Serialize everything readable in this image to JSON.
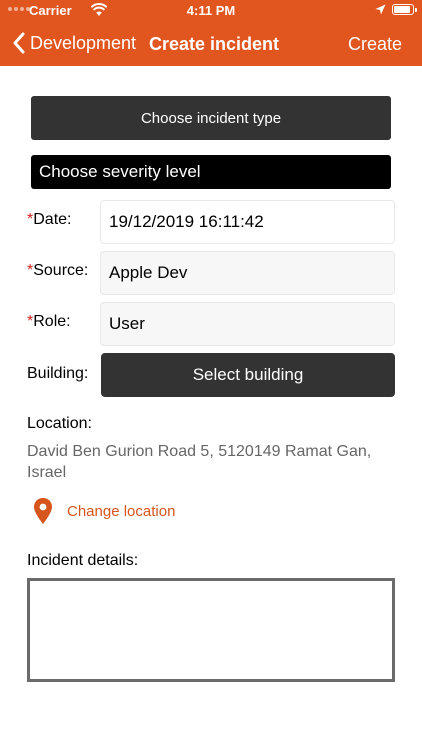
{
  "status_bar": {
    "carrier": "Carrier",
    "time": "4:11 PM",
    "battery_level": 0.95
  },
  "nav": {
    "back_label": "Development",
    "title": "Create incident",
    "action_label": "Create"
  },
  "form": {
    "incident_type_label": "Choose incident type",
    "severity_label": "Choose severity level",
    "required_mark": "*",
    "date_label": "Date:",
    "date_value": "19/12/2019 16:11:42",
    "source_label": "Source:",
    "source_value": "Apple Dev",
    "role_label": "Role:",
    "role_value": "User",
    "building_label": "Building:",
    "building_button": "Select building",
    "location_label": "Location:",
    "address": "David Ben Gurion Road 5, 5120149 Ramat Gan, Israel",
    "change_location": "Change location",
    "details_label": "Incident details:",
    "details_value": ""
  },
  "colors": {
    "accent": "#e1551f",
    "link": "#d5551d",
    "required": "#d0201c",
    "dark_button": "#333333"
  },
  "icons": [
    "signal-dots-icon",
    "wifi-icon",
    "location-arrow-icon",
    "battery-icon",
    "chevron-left-icon",
    "map-pin-icon"
  ]
}
